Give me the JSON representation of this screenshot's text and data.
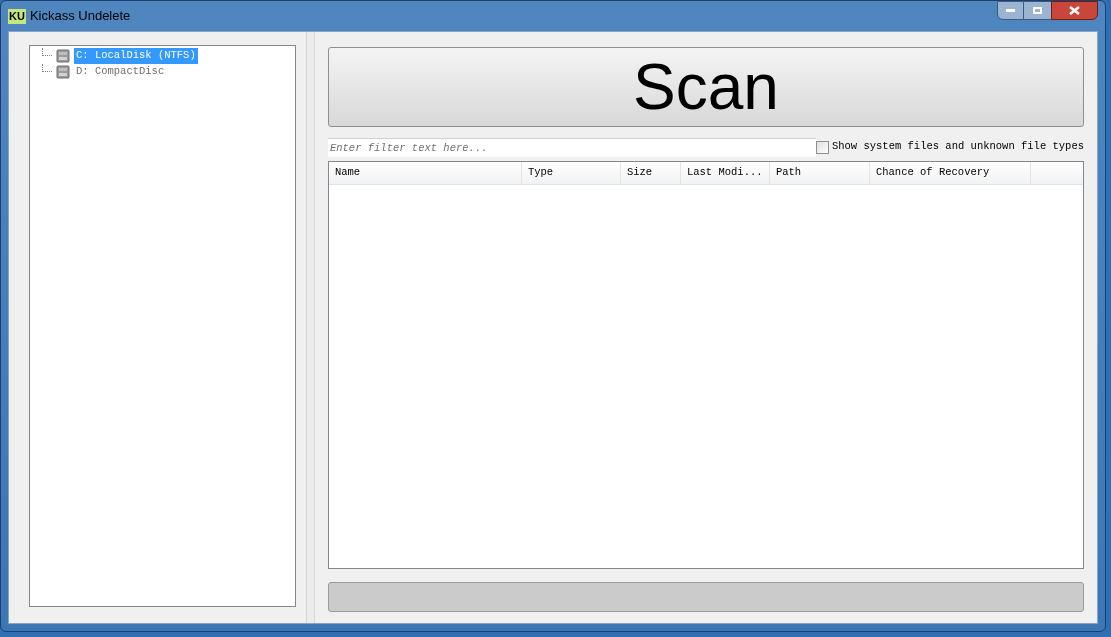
{
  "window": {
    "logo": "KU",
    "title": "Kickass Undelete"
  },
  "drives": [
    {
      "label": "C: LocalDisk (NTFS)",
      "selected": true
    },
    {
      "label": "D: CompactDisc",
      "selected": false
    }
  ],
  "scan_button": "Scan",
  "filter": {
    "placeholder": "Enter filter text here..."
  },
  "show_system": {
    "label": "Show system files and unknown file types",
    "checked": false
  },
  "table": {
    "columns": [
      "Name",
      "Type",
      "Size",
      "Last Modi...",
      "Path",
      "Chance of Recovery"
    ]
  },
  "progress": {
    "level": 0
  }
}
